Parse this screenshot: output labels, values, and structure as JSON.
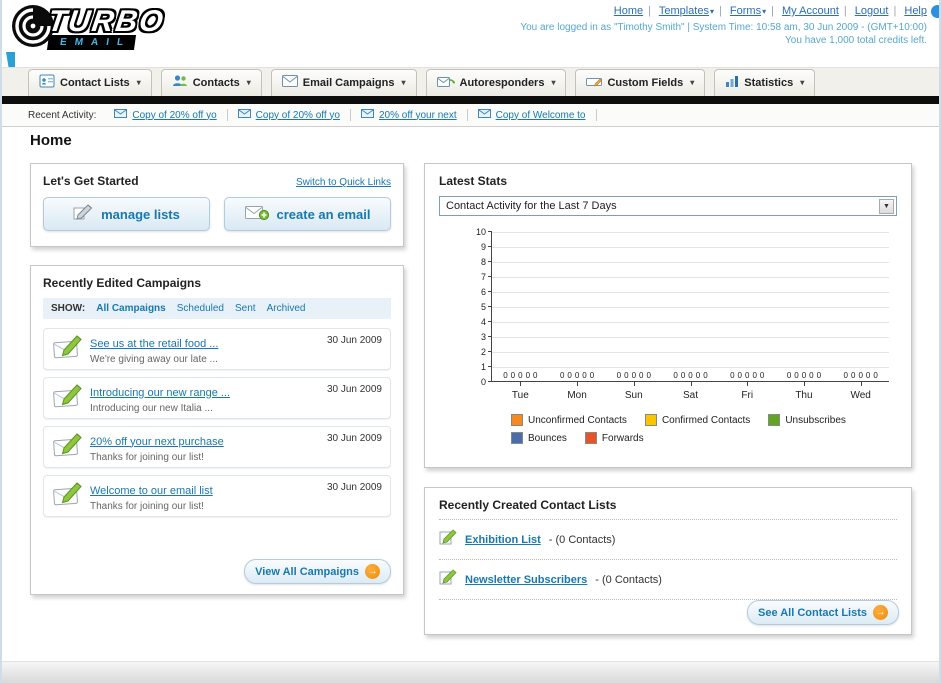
{
  "header": {
    "logo_title": "TURBO",
    "logo_subtitle": "EMAIL",
    "links": [
      {
        "label": "Home"
      },
      {
        "label": "Templates"
      },
      {
        "label": "Forms"
      },
      {
        "label": "My Account"
      },
      {
        "label": "Logout"
      },
      {
        "label": "Help"
      }
    ],
    "login_info": "You are logged in as \"Timothy Smith\" | System Time: 10:58 am, 30 Jun 2009 - (GMT+10:00)",
    "credits_info": "You have 1,000 total credits left."
  },
  "nav": {
    "tabs": [
      {
        "label": "Contact Lists"
      },
      {
        "label": "Contacts"
      },
      {
        "label": "Email Campaigns"
      },
      {
        "label": "Autoresponders"
      },
      {
        "label": "Custom Fields"
      },
      {
        "label": "Statistics"
      }
    ]
  },
  "recent_activity": {
    "label": "Recent Activity:",
    "items": [
      {
        "label": "Copy of 20% off yo"
      },
      {
        "label": "Copy of 20% off yo"
      },
      {
        "label": "20% off your next"
      },
      {
        "label": "Copy of Welcome to"
      }
    ]
  },
  "page": {
    "title": "Home"
  },
  "get_started": {
    "title": "Let's Get Started",
    "quick_links_label": "Switch to Quick Links",
    "manage_lists_label": "manage lists",
    "create_email_label": "create an email"
  },
  "campaigns": {
    "title": "Recently Edited Campaigns",
    "show_label": "SHOW:",
    "filters": [
      {
        "label": "All Campaigns",
        "active": true
      },
      {
        "label": "Scheduled",
        "active": false
      },
      {
        "label": "Sent",
        "active": false
      },
      {
        "label": "Archived",
        "active": false
      }
    ],
    "items": [
      {
        "title": "See us at the retail food ...",
        "subtitle": "We're giving away our late ...",
        "date": "30 Jun 2009"
      },
      {
        "title": "Introducing our new range ...",
        "subtitle": "Introducing our new Italia ...",
        "date": "30 Jun 2009"
      },
      {
        "title": "20% off your next purchase",
        "subtitle": "Thanks for joining our list!",
        "date": "30 Jun 2009"
      },
      {
        "title": "Welcome to our email list",
        "subtitle": "Thanks for joining our list!",
        "date": "30 Jun 2009"
      }
    ],
    "view_all_label": "View All Campaigns"
  },
  "stats": {
    "title": "Latest Stats",
    "dropdown_value": "Contact Activity for the Last 7 Days",
    "chart_data": {
      "type": "bar",
      "title": "Contact Activity for the Last 7 Days",
      "categories": [
        "Tue",
        "Mon",
        "Sun",
        "Sat",
        "Fri",
        "Thu",
        "Wed"
      ],
      "series": [
        {
          "name": "Unconfirmed Contacts",
          "color": "#f6891f",
          "values": [
            0,
            0,
            0,
            0,
            0,
            0,
            0
          ]
        },
        {
          "name": "Confirmed Contacts",
          "color": "#fdc500",
          "values": [
            0,
            0,
            0,
            0,
            0,
            0,
            0
          ]
        },
        {
          "name": "Unsubscribes",
          "color": "#61a522",
          "values": [
            0,
            0,
            0,
            0,
            0,
            0,
            0
          ]
        },
        {
          "name": "Bounces",
          "color": "#4a6ea9",
          "values": [
            0,
            0,
            0,
            0,
            0,
            0,
            0
          ]
        },
        {
          "name": "Forwards",
          "color": "#e8532a",
          "values": [
            0,
            0,
            0,
            0,
            0,
            0,
            0
          ]
        }
      ],
      "ylim": [
        0,
        10
      ],
      "ytick_step": 1,
      "grid": true,
      "legend_position": "bottom"
    }
  },
  "contact_lists": {
    "title": "Recently Created Contact Lists",
    "items": [
      {
        "name": "Exhibition List",
        "count": "- (0 Contacts)"
      },
      {
        "name": "Newsletter Subscribers",
        "count": "- (0 Contacts)"
      }
    ],
    "see_all_label": "See All Contact Lists"
  },
  "colors": {
    "accent_link": "#1878b0",
    "header_link": "#2b6db6",
    "orange_accent": "#f7941d",
    "black_bar": "#0d0d0d"
  }
}
